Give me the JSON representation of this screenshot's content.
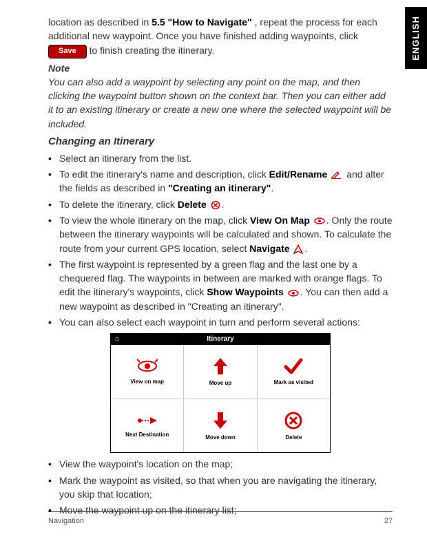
{
  "language_tab": "ENGLISH",
  "intro": {
    "prefix": "location as described in ",
    "ref": "5.5  \"How to Navigate\"",
    "mid": " , repeat the process for each additional new waypoint. Once you have finished adding waypoints, click ",
    "save": "Save",
    "end": " to finish creating the itinerary."
  },
  "note": {
    "head": "Note",
    "body": "You can also add a waypoint by selecting any point on the map, and then clicking the waypoint button shown on the context bar. Then you can either add it to an existing itinerary or create a new one where the selected waypoint will be included."
  },
  "subhead": "Changing an Itinerary",
  "bullets": {
    "b1": "Select an itinerary from the list.",
    "b2a": "To edit the itinerary's name and description, click ",
    "b2b": "Edit/Rename",
    "b2c": " and alter the fields as described in ",
    "b2d": "\"Creating an itinerary\"",
    "b2e": ".",
    "b3a": "To delete the itinerary, click ",
    "b3b": "Delete",
    "b3c": ".",
    "b4a": "To view the whole itinerary on the map, click ",
    "b4b": "View On Map",
    "b4c": ". Only the route between the itinerary waypoints will be calculated and shown. To calculate the route from your current GPS location, select ",
    "b4d": "Navigate",
    "b4e": ".",
    "b5a": "The first waypoint is represented by a green flag and the last one by a chequered flag. The waypoints in between are marked with orange flags. To edit the itinerary's waypoints, click ",
    "b5b": "Show Waypoints",
    "b5c": ". You can then add a new waypoint as described in \"Creating an itinerary\".",
    "b6": "You can also select each waypoint in turn and perform several actions:"
  },
  "figure": {
    "title": "Itinerary",
    "cells": [
      "View on map",
      "Move up",
      "Mark as visited",
      "Next Destination",
      "Move down",
      "Delete"
    ]
  },
  "bullets2": {
    "c1": "View the waypoint's location on the map;",
    "c2": "Mark the waypoint as visited, so that when you are navigating the itinerary, you skip that location;",
    "c3": "Move the waypoint up on the itinerary list;"
  },
  "footer": {
    "section": "Navigation",
    "page": "27"
  }
}
